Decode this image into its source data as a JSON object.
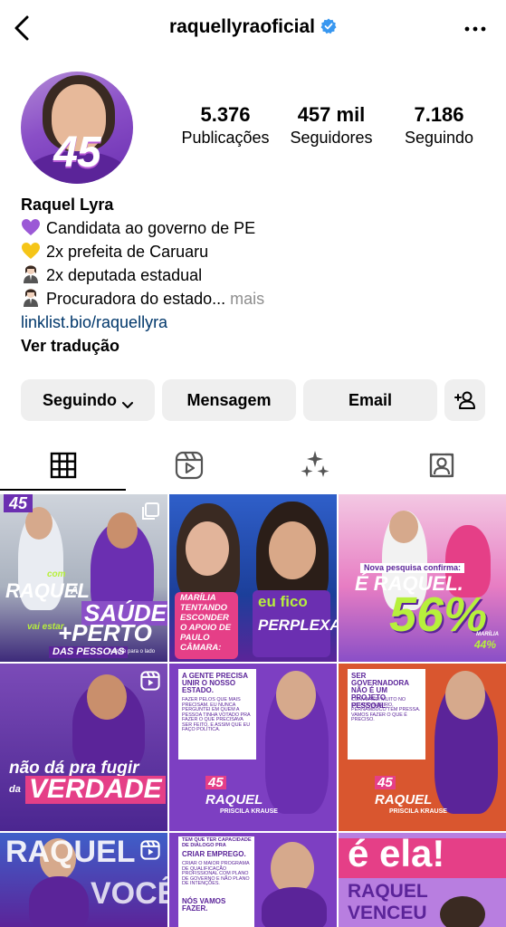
{
  "header": {
    "username": "raquellyraoficial",
    "back_icon": "chevron-left-icon",
    "verified_icon": "verified-badge-icon",
    "more_icon": "ellipsis-icon"
  },
  "profile": {
    "avatar_number": "45",
    "stats": [
      {
        "value": "5.376",
        "label": "Publicações"
      },
      {
        "value": "457 mil",
        "label": "Seguidores"
      },
      {
        "value": "7.186",
        "label": "Seguindo"
      }
    ],
    "name": "Raquel Lyra",
    "bio_lines": [
      {
        "emoji": "purple-heart",
        "text": "Candidata ao governo de PE"
      },
      {
        "emoji": "yellow-heart",
        "text": "2x prefeita de Caruaru"
      },
      {
        "emoji": "woman-office-worker",
        "text": "2x deputada estadual"
      },
      {
        "emoji": "woman-office-worker",
        "text": "Procuradora do estado..."
      }
    ],
    "more": "mais",
    "link": "linklist.bio/raquellyra",
    "translate": "Ver tradução"
  },
  "actions": {
    "following": "Seguindo",
    "message": "Mensagem",
    "email": "Email",
    "add_person_icon": "add-person-icon"
  },
  "tabs": [
    "grid-icon",
    "reels-icon",
    "sparkles-icon",
    "tagged-icon"
  ],
  "posts": {
    "p1": {
      "top": "45",
      "l1": "com",
      "l2": "RAQUEL",
      "l3": "A",
      "l4": "SAÚDE",
      "l5": "vai estar",
      "l6": "+PERTO",
      "l7": "DAS PESSOAS",
      "small": "Arraste para o lado"
    },
    "p2": {
      "l1": "MARÍLIA",
      "l2": "TENTANDO",
      "l3": "ESCONDER",
      "l4": "O APOIO DE",
      "l5": "PAULO",
      "l6": "CÂMARA:",
      "r1": "eu fico",
      "r2": "PERPLEXA."
    },
    "p3": {
      "tag": "Nova pesquisa confirma:",
      "l1": "É RAQUEL.",
      "l2": "56%",
      "l3": "44%",
      "l3b": "MARÍLIA"
    },
    "p4": {
      "l1": "não dá pra fugir",
      "l2": "da",
      "l3": "VERDADE"
    },
    "p5": {
      "q": "A GENTE PRECISA UNIR O NOSSO ESTADO.",
      "b": "FAZER PELOS QUE MAIS PRECISAM. EU NUNCA PERGUNTEI EM QUEM A PESSOA TINHA VOTADO PRA FAZER O QUE PRECISAVA SER FEITO. E ASSIM QUE EU FAÇO POLÍTICA.",
      "n": "45",
      "name": "RAQUEL",
      "vice": "PRISCILA KRAUSE"
    },
    "p6": {
      "q": "SER GOVERNADORA NÃO É UM PROJETO PESSOAL.",
      "b": "CONVERSEI MUITO NO ESTADO INTEIRO, PERNAMBUCO TEM PRESSA. VAMOS FAZER O QUE É PRECISO.",
      "n": "45",
      "name": "RAQUEL",
      "vice": "PRISCILA KRAUSE"
    },
    "p7": {
      "l1": "RAQUEL",
      "l2": "VOCÊ"
    },
    "p8": {
      "q": "TEM QUE TER CAPACIDADE DE DIÁLOGO PRA",
      "q2": "CRIAR EMPREGO.",
      "b": "CRIAR O MAIOR PROGRAMA DE QUALIFICAÇÃO PROFISSIONAL COM PLANO DE GOVERNO E NÃO PLANO DE INTENÇÕES.",
      "end": "NÓS VAMOS FAZER."
    },
    "p9": {
      "l1": "é ela!",
      "l2": "RAQUEL",
      "l3": "VENCEU"
    }
  },
  "colors": {
    "purple": "#5b2499",
    "pink": "#e53f87",
    "lime": "#b7f03c",
    "link": "#00376b",
    "verified": "#3897f0"
  }
}
